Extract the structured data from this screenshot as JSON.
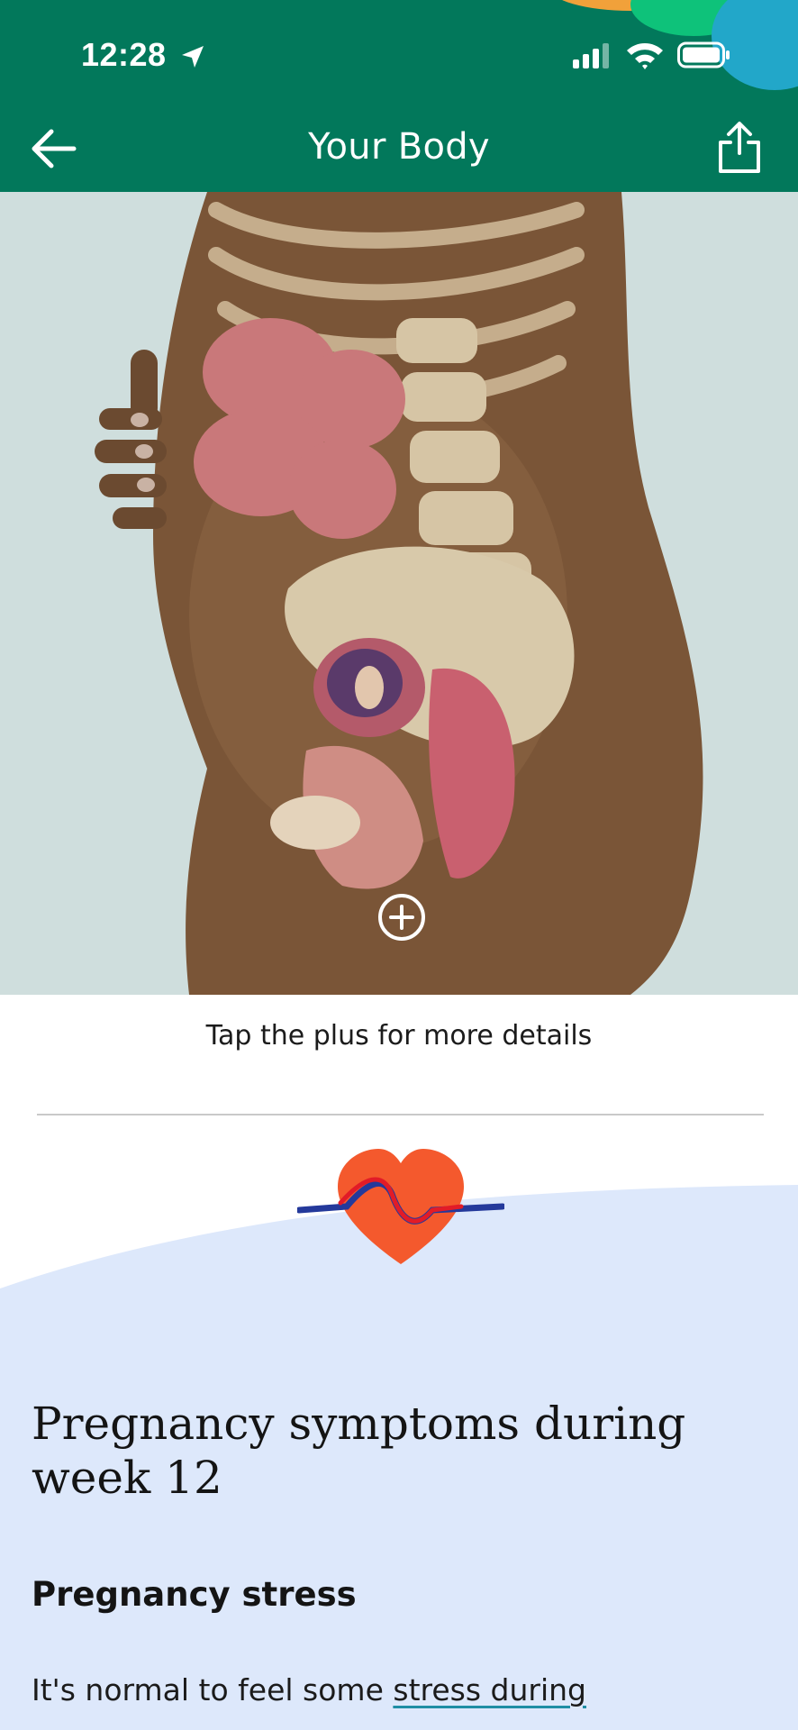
{
  "status_bar": {
    "time": "12:28"
  },
  "header": {
    "title": "Your Body",
    "back_icon": "arrow-left-icon",
    "share_icon": "share-icon"
  },
  "illustration": {
    "hotspot_icon": "plus-circle-icon"
  },
  "caption": "Tap the plus for more details",
  "symptoms": {
    "title": "Pregnancy symptoms during week 12",
    "subtitle": "Pregnancy stress",
    "body_prefix": "It's normal to feel some ",
    "body_link": "stress during"
  },
  "colors": {
    "header": "#02785b",
    "illustration_bg": "#cfdedd",
    "panel_bg": "#dde8fb",
    "heart": "#f4592d",
    "link_underline": "#1f8ea5"
  }
}
